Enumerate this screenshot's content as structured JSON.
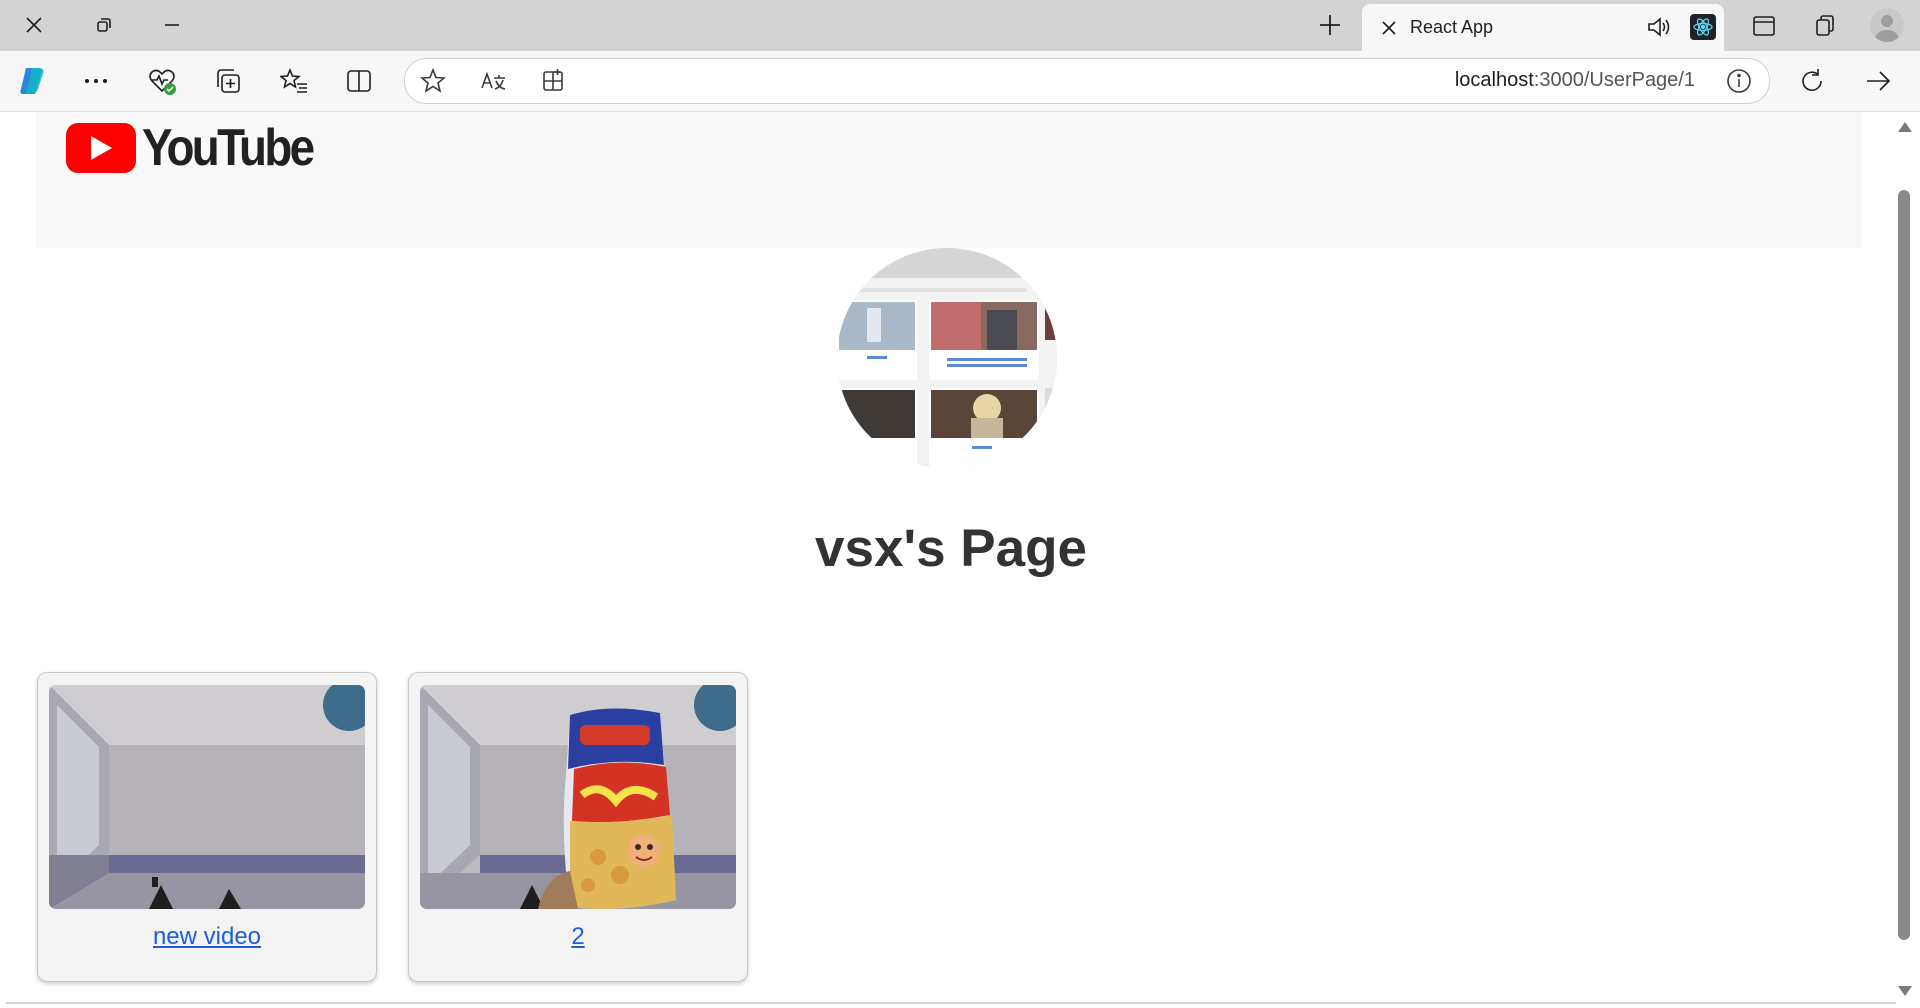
{
  "browser": {
    "tab": {
      "title": "React App",
      "favicon": "react-logo-icon"
    },
    "url": {
      "host": "localhost",
      "rest": ":3000/UserPage/1"
    }
  },
  "page": {
    "logo_text": "YouTube",
    "title": "vsx's Page",
    "videos": [
      {
        "title": "new video"
      },
      {
        "title": "2"
      }
    ]
  },
  "colors": {
    "youtube_red": "#ff0000",
    "link": "#1a5fd8",
    "title_text": "#333333"
  }
}
